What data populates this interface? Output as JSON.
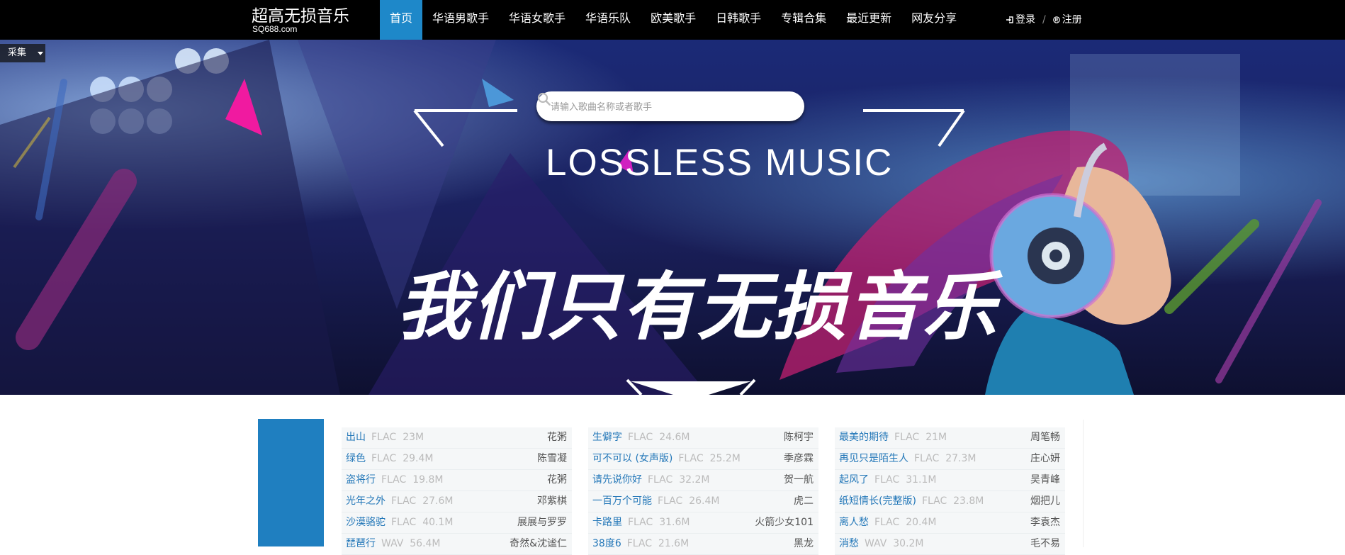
{
  "site": {
    "title": "超高无损音乐",
    "domain": "SQ688.com"
  },
  "nav": {
    "items": [
      {
        "label": "首页",
        "active": true
      },
      {
        "label": "华语男歌手"
      },
      {
        "label": "华语女歌手"
      },
      {
        "label": "华语乐队"
      },
      {
        "label": "欧美歌手"
      },
      {
        "label": "日韩歌手"
      },
      {
        "label": "专辑合集"
      },
      {
        "label": "最近更新"
      },
      {
        "label": "网友分享"
      }
    ],
    "login": "登录",
    "separator": "/",
    "register": "注册"
  },
  "caiji": {
    "label": "采集"
  },
  "search": {
    "placeholder": "请输入歌曲名称或者歌手"
  },
  "banner": {
    "headline_en": "LOSSLESS MUSIC",
    "headline_cn": "我们只有无损音乐"
  },
  "songs": {
    "col1": [
      {
        "title": "出山",
        "format": "FLAC",
        "size": "23M",
        "singer": "花粥"
      },
      {
        "title": "绿色",
        "format": "FLAC",
        "size": "29.4M",
        "singer": "陈雪凝"
      },
      {
        "title": "盗将行",
        "format": "FLAC",
        "size": "19.8M",
        "singer": "花粥"
      },
      {
        "title": "光年之外",
        "format": "FLAC",
        "size": "27.6M",
        "singer": "邓紫棋"
      },
      {
        "title": "沙漠骆驼",
        "format": "FLAC",
        "size": "40.1M",
        "singer": "展展与罗罗"
      },
      {
        "title": "琵琶行",
        "format": "WAV",
        "size": "56.4M",
        "singer": "奇然&沈谧仁"
      }
    ],
    "col2": [
      {
        "title": "生僻字",
        "format": "FLAC",
        "size": "24.6M",
        "singer": "陈柯宇"
      },
      {
        "title": "可不可以 (女声版)",
        "format": "FLAC",
        "size": "25.2M",
        "singer": "季彦霖"
      },
      {
        "title": "请先说你好",
        "format": "FLAC",
        "size": "32.2M",
        "singer": "贺一航"
      },
      {
        "title": "一百万个可能",
        "format": "FLAC",
        "size": "26.4M",
        "singer": "虎二"
      },
      {
        "title": "卡路里",
        "format": "FLAC",
        "size": "31.6M",
        "singer": "火箭少女101"
      },
      {
        "title": "38度6",
        "format": "FLAC",
        "size": "21.6M",
        "singer": "黑龙"
      }
    ],
    "col3": [
      {
        "title": "最美的期待",
        "format": "FLAC",
        "size": "21M",
        "singer": "周笔畅"
      },
      {
        "title": "再见只是陌生人",
        "format": "FLAC",
        "size": "27.3M",
        "singer": "庄心妍"
      },
      {
        "title": "起风了",
        "format": "FLAC",
        "size": "31.1M",
        "singer": "吴青峰"
      },
      {
        "title": "纸短情长(完整版)",
        "format": "FLAC",
        "size": "23.8M",
        "singer": "烟把儿"
      },
      {
        "title": "离人愁",
        "format": "FLAC",
        "size": "20.4M",
        "singer": "李袁杰"
      },
      {
        "title": "消愁",
        "format": "WAV",
        "size": "30.2M",
        "singer": "毛不易"
      }
    ]
  },
  "colors": {
    "accent": "#1e88c9",
    "link": "#2377b8",
    "nav_bg": "#000000"
  }
}
